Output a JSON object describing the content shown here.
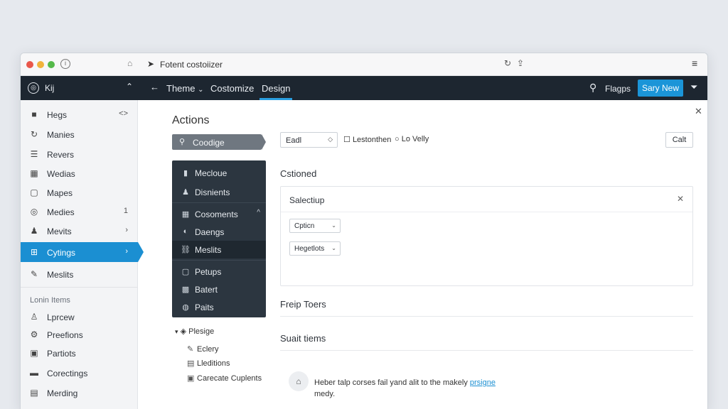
{
  "browser": {
    "url_title": "Fotent costoiizer"
  },
  "topnav": {
    "site_label": "Kij",
    "back_glyph": "←",
    "theme_label": "Theme",
    "customize_label": "Costomize",
    "design_label": "Design",
    "search_label": "Flagps",
    "new_button_label": "Sary New"
  },
  "sidebar": {
    "items": [
      {
        "label": "Hegs",
        "icon": "square-icon",
        "end": "<>"
      },
      {
        "label": "Manies",
        "icon": "refresh-icon",
        "end": ""
      },
      {
        "label": "Revers",
        "icon": "list-icon",
        "end": ""
      },
      {
        "label": "Wedias",
        "icon": "grid-icon",
        "end": ""
      },
      {
        "label": "Mapes",
        "icon": "map-icon",
        "end": ""
      },
      {
        "label": "Medies",
        "icon": "target-icon",
        "end": "1"
      },
      {
        "label": "Mevits",
        "icon": "user-icon",
        "end": "›"
      },
      {
        "label": "Cytings",
        "icon": "settings-icon",
        "end": "›"
      },
      {
        "label": "Meslits",
        "icon": "pencil-icon",
        "end": ""
      }
    ],
    "section_label": "Lonin Items",
    "sub_items": [
      {
        "label": "Lprcew",
        "icon": "person-icon"
      },
      {
        "label": "Preefions",
        "icon": "gear-icon"
      },
      {
        "label": "Partiots",
        "icon": "image-icon"
      },
      {
        "label": "Corectings",
        "icon": "folder-icon"
      },
      {
        "label": "Merding",
        "icon": "calendar-icon"
      }
    ]
  },
  "actions": {
    "title": "Actions",
    "search_label": "Coodige",
    "menu": [
      {
        "label": "Mecloue",
        "icon": "doc-icon",
        "end": ""
      },
      {
        "label": "Disnients",
        "icon": "person-icon",
        "end": ""
      },
      {
        "label": "Cosoments",
        "icon": "grid-icon",
        "end": "^"
      },
      {
        "label": "Daengs",
        "icon": "palette-icon",
        "end": ""
      },
      {
        "label": "Meslits",
        "icon": "link-icon",
        "end": ""
      },
      {
        "label": "Petups",
        "icon": "frame-icon",
        "end": ""
      },
      {
        "label": "Batert",
        "icon": "layers-icon",
        "end": ""
      },
      {
        "label": "Paits",
        "icon": "paint-icon",
        "end": ""
      }
    ],
    "tree_head": "Plesige",
    "tree": [
      {
        "label": "Eclery",
        "icon": "pencil-icon"
      },
      {
        "label": "Lleditions",
        "icon": "page-icon"
      },
      {
        "label": "Carecate Cuplents",
        "icon": "box-icon"
      }
    ]
  },
  "panel": {
    "select_value": "Eadl",
    "checkbox_1": "Lestonthen",
    "checkbox_2": "Lo Velly",
    "cancel_label": "Calt",
    "section_heading": "Cstioned",
    "card": {
      "title": "Salectiup",
      "select_1": "Cpticn",
      "select_2": "Hegetlots"
    },
    "row_1": "Freip Toers",
    "row_2": "Suait tiems",
    "notice_text": "Heber talp corses fail yand alit to the makely",
    "notice_link": "prsigne",
    "notice_tail": "medy."
  }
}
